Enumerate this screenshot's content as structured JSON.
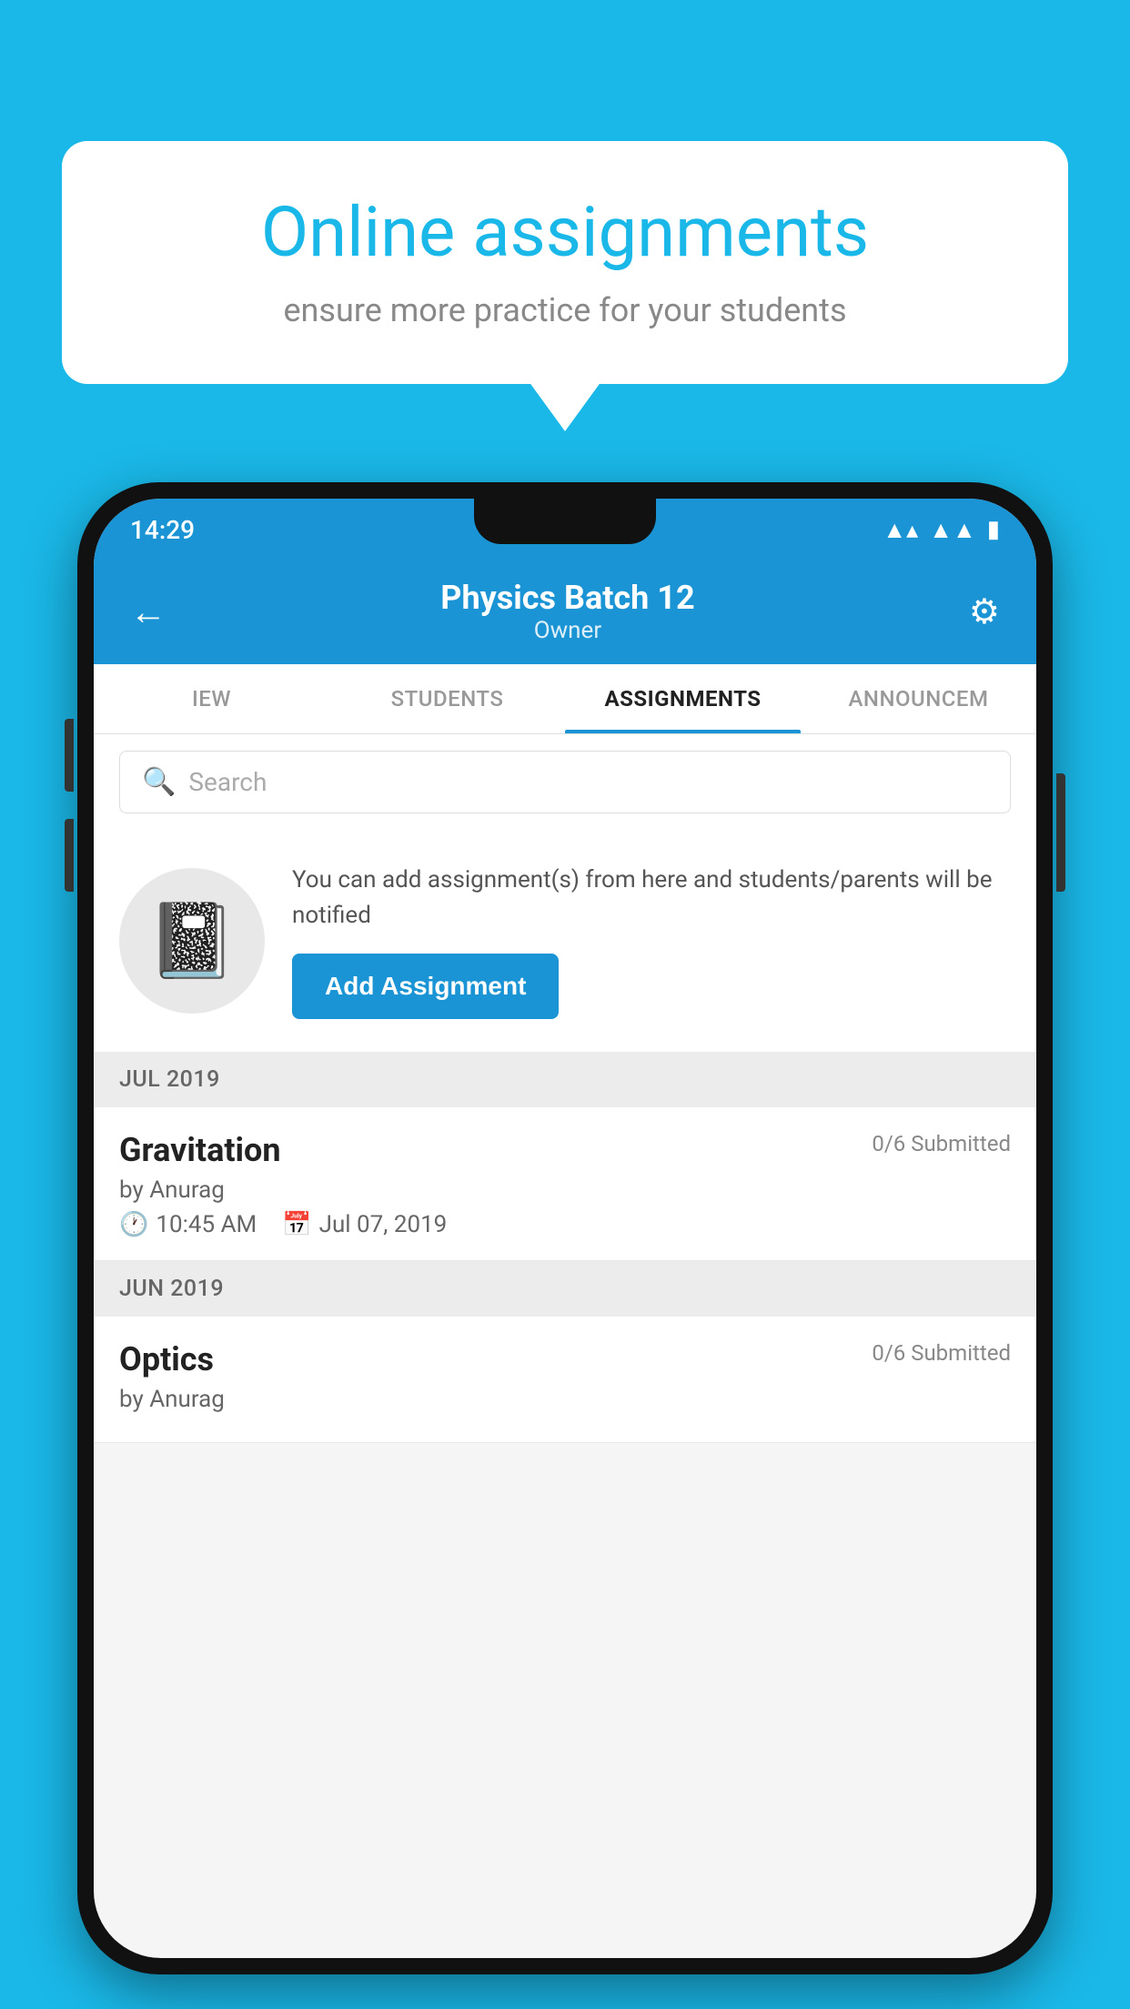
{
  "background": {
    "color": "#1ab8e8"
  },
  "speech_bubble": {
    "title": "Online assignments",
    "subtitle": "ensure more practice for your students"
  },
  "status_bar": {
    "time": "14:29",
    "wifi": "▾",
    "signal": "▾",
    "battery": "▮"
  },
  "app_bar": {
    "title": "Physics Batch 12",
    "subtitle": "Owner",
    "back_label": "←",
    "settings_label": "⚙"
  },
  "tabs": [
    {
      "label": "IEW",
      "active": false
    },
    {
      "label": "STUDENTS",
      "active": false
    },
    {
      "label": "ASSIGNMENTS",
      "active": true
    },
    {
      "label": "ANNOUNCEM",
      "active": false
    }
  ],
  "search": {
    "placeholder": "Search"
  },
  "promo": {
    "text": "You can add assignment(s) from here and students/parents will be notified",
    "button_label": "Add Assignment"
  },
  "sections": [
    {
      "month": "JUL 2019",
      "assignments": [
        {
          "name": "Gravitation",
          "submitted": "0/6 Submitted",
          "by": "by Anurag",
          "time": "10:45 AM",
          "date": "Jul 07, 2019"
        }
      ]
    },
    {
      "month": "JUN 2019",
      "assignments": [
        {
          "name": "Optics",
          "submitted": "0/6 Submitted",
          "by": "by Anurag",
          "time": "",
          "date": ""
        }
      ]
    }
  ]
}
